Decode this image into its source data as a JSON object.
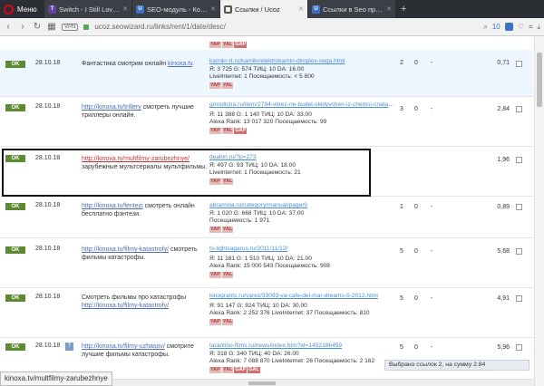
{
  "browser": {
    "menu_label": "Меню",
    "tabs": [
      {
        "label": "Switch - I Still Love You |",
        "icon": "twitch-icon",
        "color": "#6441a4",
        "glyph": "T"
      },
      {
        "label": "SEO-модуль - Комплекс",
        "icon": "ucoz-icon",
        "color": "#3a73c6",
        "glyph": "U"
      },
      {
        "label": "Ссылки / Ucoz",
        "icon": "grid-icon",
        "color": "#555",
        "glyph": "▦"
      },
      {
        "label": "Ссылки в Seo продвиж",
        "icon": "ucoz-icon",
        "color": "#3a73c6",
        "glyph": "U"
      }
    ],
    "vpn": "VPN",
    "url": "ucoz.seowizard.ru/links/rent/1/date/desc/",
    "badge": "10"
  },
  "rows": [
    {
      "status": "OK",
      "date": "28.10.18",
      "ad_pre": "Фантастика смотрим онлайн ",
      "ad_link": "kinoxa.tv",
      "ad_link_red": false,
      "ad_post": ".",
      "ad_extra": "",
      "site_url": "kamikr-rt.ru/kamikr/elektrokamin-dimplex-vega.html",
      "l1": "Я: 3 725   G: 574   ТИЦ: 10   DA: 16.00",
      "l2": "LiveInternet: 1   Посещаемость: < 5 800",
      "l3": "",
      "c1": "2",
      "c2": "0",
      "c3": "-",
      "price": "0,71"
    },
    {
      "status": "OK",
      "date": "28.10.18",
      "ad_pre": "",
      "ad_link": "http://kinoxa.tv/trillery",
      "ad_link_red": false,
      "ad_post": " смотреть лучшие триллеры онлайн.",
      "ad_extra": "",
      "site_url": "gorodistra.ru/item/2794-vitrez-ne-budet-skidyvchen-iz-chemsi-cnata-tut",
      "l1": "Я: 11 388   G: 1 140   ТИЦ: 10   DA: 33.00",
      "l2": "Alexa Rank: 13 017 320   Посещаемость: 99",
      "l3": "",
      "c1": "3",
      "c2": "0",
      "c3": "-",
      "price": "2,84"
    },
    {
      "status": "OK",
      "date": "28.10.18",
      "ad_pre": "",
      "ad_link": "http://kinoxa.tv/multfilmy-zarubezhnye/",
      "ad_link_red": true,
      "ad_post": "",
      "ad_extra": "зарубежные мультсериалы мультфильмы.",
      "site_url": "dealon.ru/?p=273",
      "l1": "Я: 497   G: 93   ТИЦ: 10   DA: 18.00",
      "l2": "LiveInternet: 1   Посещаемость: 21",
      "l3": "",
      "c1": "",
      "c2": "",
      "c3": "",
      "price": "1,96"
    },
    {
      "status": "OK",
      "date": "28.10.18",
      "ad_pre": "",
      "ad_link": "http://kinoxa.tv/fentezi",
      "ad_link_red": false,
      "ad_post": " смотреть онлайн бесплатно фэнтези.",
      "ad_extra": "",
      "site_url": "abramola.ru/category/manual/page/9",
      "l1": "Я: 1 020   G: 668   ТИЦ: 10   DA: 37.00",
      "l2": "Посещаемость: 1 971",
      "l3": "",
      "c1": "1",
      "c2": "0",
      "c3": "-",
      "price": "0,89"
    },
    {
      "status": "OK",
      "date": "28.10.18",
      "ad_pre": "",
      "ad_link": "http://kinoxa.tv/filmy-katastrofy/",
      "ad_link_red": false,
      "ad_post": " смотреть фильмы катастрофы.",
      "ad_extra": "",
      "site_url": "tv-lightsagarus.ru/2011/11/12/",
      "l1": "Я: 11 181   G: 1 510   ТИЦ: 10   DA: 21.00",
      "l2": "Alexa Rank: 15 000 543   Посещаемость: 908",
      "l3": "",
      "c1": "5",
      "c2": "0",
      "c3": "-",
      "price": "5,68"
    },
    {
      "status": "OK",
      "date": "28.10.18",
      "ad_pre": "Смотреть фильмы про катастрофы ",
      "ad_link": "http://kinoxa.tv/filmy-katastrofy/",
      "ad_link_red": false,
      "ad_post": "",
      "ad_extra": "",
      "site_url": "kinogrants.ru/varez/33093-va-cafe-del-mar-dreams-5-2012.html",
      "l1": "Я: 91 147   G: 924   ТИЦ: 10   DA: 30.00",
      "l2": "Alexa Rank: 2 252 376   LiveInternet: 37   Посещаемость: 810",
      "l3": "",
      "c1": "5",
      "c2": "0",
      "c3": "-",
      "price": "4,91"
    },
    {
      "status": "OK",
      "date": "28.10.18",
      "ad_pre": "",
      "ad_link": "http://kinoxa.tv/filmy-uzhasov/",
      "ad_link_red": false,
      "ad_post": " смотрите лучшие фильмы катастрофы.",
      "ad_extra": "",
      "site_url": "tarantino-films.ru/news/index.htm?id=1452186459",
      "l1": "Я: 318   G: 340   ТИЦ: 40   DA: 26.00",
      "l2": "Alexa Rank: 7 088 870   LiveInternet: 26   Посещаемость: 2 162",
      "l3": "",
      "c1": "5",
      "c2": "0",
      "c3": "-",
      "price": "5,96"
    }
  ],
  "se_labels": {
    "yap": "YAP",
    "yal": "YAL",
    "gap": "GAP",
    "gal": "GAL"
  },
  "row_icon_t": "T",
  "status_url": "kinoxa.tv/multfilmy-zarubezhnye",
  "summary": "Выбрано ссылок 2, на сумму 2.84"
}
